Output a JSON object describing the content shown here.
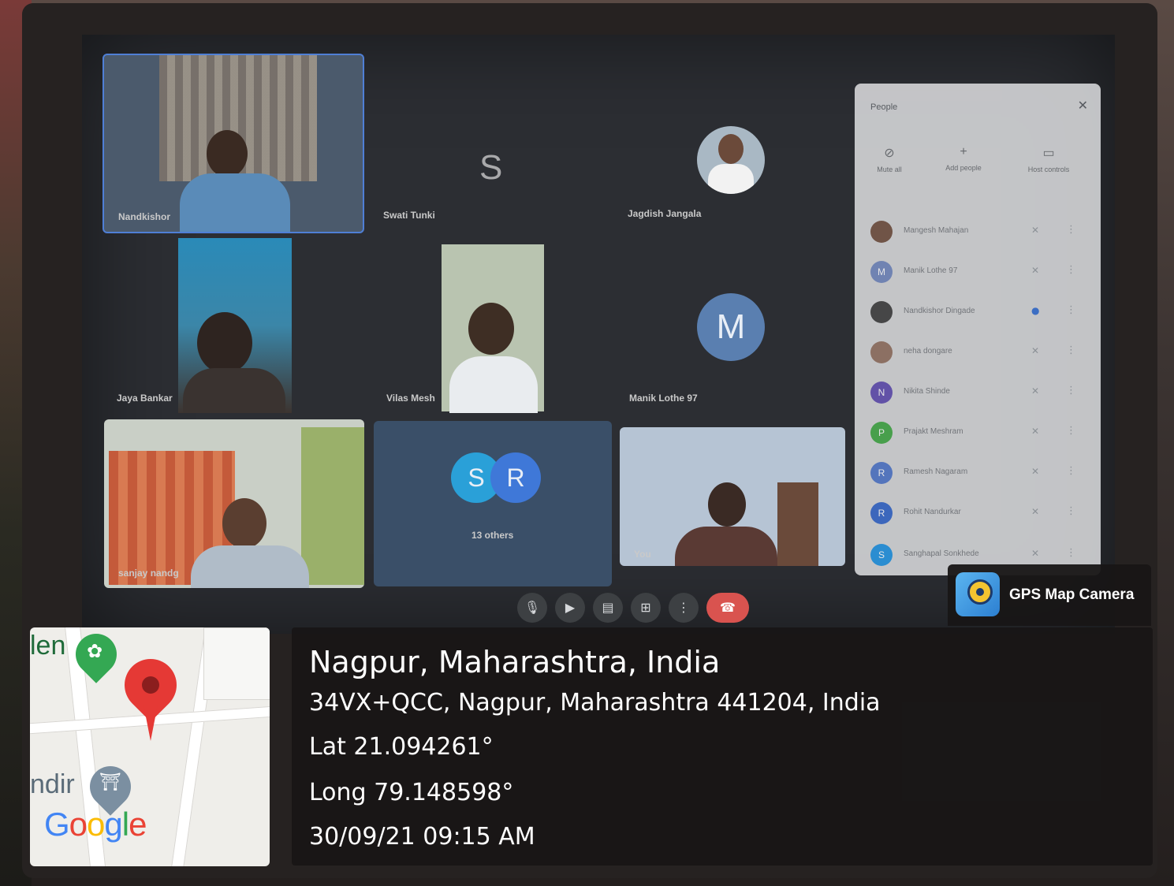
{
  "meeting": {
    "participants_grid": [
      {
        "name": "Nandkishor"
      },
      {
        "name": "Swati Tunki",
        "letter": "S"
      },
      {
        "name": "Jagdish Jangala"
      },
      {
        "name": "Jaya Bankar"
      },
      {
        "name": "Vilas Mesh"
      },
      {
        "name": "Manik Lothe 97",
        "letter": "M"
      },
      {
        "name": "sanjay nandg"
      },
      {
        "name": "13 others",
        "letters": [
          "S",
          "R"
        ]
      },
      {
        "name": "You"
      }
    ],
    "people_panel": {
      "title": "People",
      "tools": [
        "Mute all",
        "Add people",
        "Host controls"
      ],
      "list": [
        {
          "initial": "",
          "name": "Mangesh Mahajan",
          "color": "#7a5a4a"
        },
        {
          "initial": "M",
          "name": "Manik Lothe 97",
          "color": "#7a8fc4"
        },
        {
          "initial": "",
          "name": "Nandkishor Dingade",
          "color": "#4a4a4a"
        },
        {
          "initial": "",
          "name": "neha dongare",
          "color": "#9a7a6a"
        },
        {
          "initial": "N",
          "name": "Nikita Shinde",
          "color": "#6a58b8"
        },
        {
          "initial": "P",
          "name": "Prajakt Meshram",
          "color": "#4caf50"
        },
        {
          "initial": "R",
          "name": "Ramesh Nagaram",
          "color": "#5a7fd0"
        },
        {
          "initial": "R",
          "name": "Rohit Nandurkar",
          "color": "#3f6fd0"
        },
        {
          "initial": "S",
          "name": "Sanghapal Sonkhede",
          "color": "#2b9be8"
        }
      ]
    },
    "controls": [
      "mic-icon",
      "camera-icon",
      "captions-icon",
      "present-icon",
      "more-icon",
      "end-call-icon"
    ]
  },
  "map": {
    "label_top": "len",
    "label_bottom": "ndir",
    "google": "Google"
  },
  "overlay": {
    "brand": "GPS Map Camera",
    "location": "Nagpur, Maharashtra, India",
    "address": "34VX+QCC, Nagpur, Maharashtra 441204, India",
    "lat": "Lat 21.094261°",
    "long": "Long 79.148598°",
    "datetime": "30/09/21 09:15 AM"
  }
}
